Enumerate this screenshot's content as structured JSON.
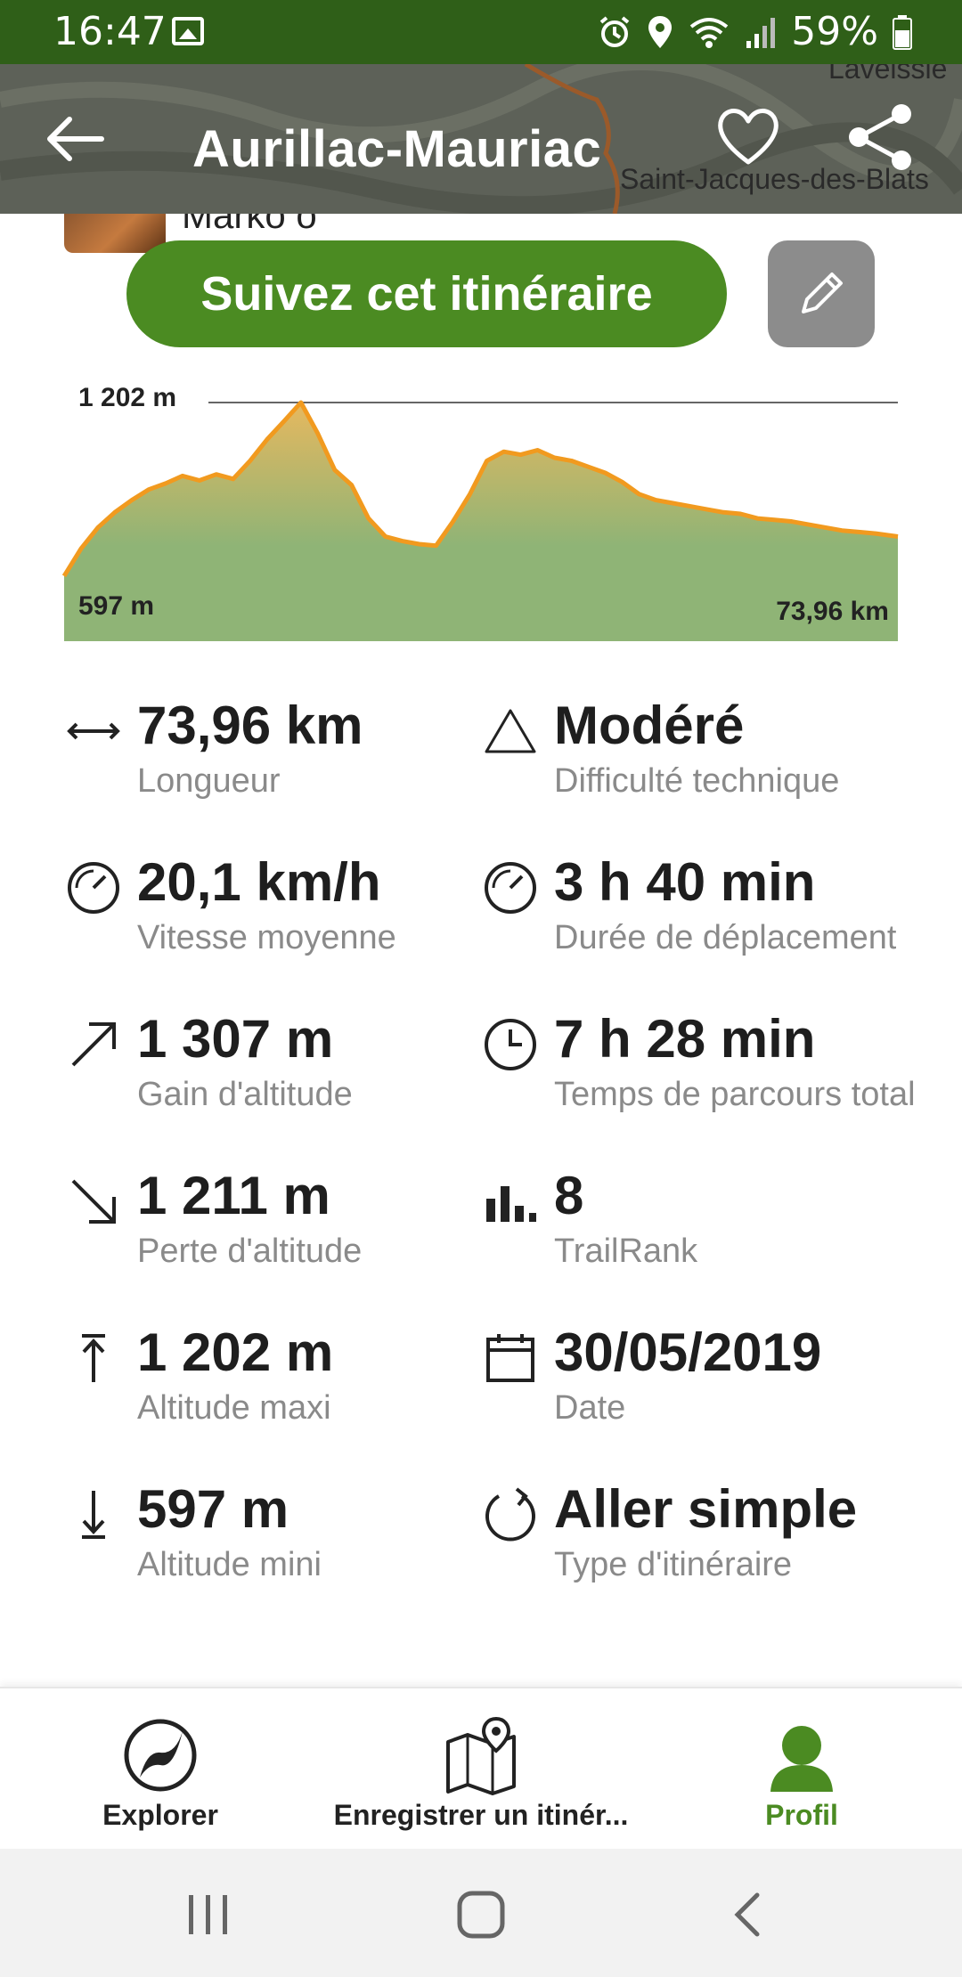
{
  "status_bar": {
    "time": "16:47",
    "battery": "59%"
  },
  "header": {
    "title": "Aurillac-Mauriac",
    "map_labels": [
      "Laveissie",
      "Saint-Jacques-des-Blats"
    ]
  },
  "author": {
    "name": "Marko o"
  },
  "actions": {
    "follow_label": "Suivez cet itinéraire"
  },
  "elevation": {
    "max_label": "1 202 m",
    "min_label": "597 m",
    "distance_label": "73,96 km",
    "fill_color": "#8fb476",
    "peak_color": "#e6b85f",
    "line_color": "#f19a1f"
  },
  "chart_data": {
    "type": "area",
    "title": "",
    "xlabel": "",
    "ylabel": "",
    "xlim": [
      0,
      73.96
    ],
    "ylim": [
      597,
      1202
    ],
    "x": [
      0,
      1.5,
      3,
      4.5,
      6,
      7.5,
      9,
      10.5,
      12,
      13.5,
      15,
      16.5,
      18,
      19.5,
      21,
      22.5,
      24,
      25.5,
      27,
      28.5,
      30,
      31.5,
      33,
      34.5,
      36,
      37.5,
      39,
      40.5,
      42,
      43.5,
      45,
      46.5,
      48,
      49.5,
      51,
      52.5,
      54,
      55.5,
      57,
      58.5,
      60,
      61.5,
      63,
      64.5,
      66,
      67.5,
      69,
      70.5,
      72,
      73.96
    ],
    "y": [
      630,
      720,
      790,
      840,
      880,
      915,
      935,
      960,
      945,
      965,
      950,
      1010,
      1080,
      1140,
      1202,
      1100,
      980,
      930,
      820,
      760,
      745,
      735,
      730,
      810,
      900,
      1010,
      1040,
      1030,
      1045,
      1020,
      1010,
      990,
      970,
      940,
      900,
      880,
      870,
      860,
      850,
      840,
      835,
      820,
      815,
      810,
      800,
      790,
      780,
      775,
      770,
      760
    ]
  },
  "stats": [
    {
      "icon": "distance-icon",
      "value": "73,96 km",
      "label": "Longueur"
    },
    {
      "icon": "difficulty-icon",
      "value": "Modéré",
      "label": "Difficulté technique"
    },
    {
      "icon": "speed-icon",
      "value": "20,1 km/h",
      "label": "Vitesse moyenne"
    },
    {
      "icon": "moving-time-icon",
      "value": "3 h 40 min",
      "label": "Durée de déplacement"
    },
    {
      "icon": "elevation-gain-icon",
      "value": "1 307 m",
      "label": "Gain d'altitude"
    },
    {
      "icon": "clock-icon",
      "value": "7 h 28 min",
      "label": "Temps de parcours total"
    },
    {
      "icon": "elevation-loss-icon",
      "value": "1 211 m",
      "label": "Perte d'altitude"
    },
    {
      "icon": "trailrank-icon",
      "value": "8",
      "label": "TrailRank"
    },
    {
      "icon": "max-altitude-icon",
      "value": "1 202 m",
      "label": "Altitude maxi"
    },
    {
      "icon": "calendar-icon",
      "value": "30/05/2019",
      "label": "Date"
    },
    {
      "icon": "min-altitude-icon",
      "value": "597 m",
      "label": "Altitude mini"
    },
    {
      "icon": "route-type-icon",
      "value": "Aller simple",
      "label": "Type d'itinéraire"
    }
  ],
  "bottom_nav": [
    {
      "icon": "explorer-icon",
      "label": "Explorer",
      "active": false
    },
    {
      "icon": "record-trail-icon",
      "label": "Enregistrer un itinér...",
      "active": false
    },
    {
      "icon": "profile-icon",
      "label": "Profil",
      "active": true
    }
  ],
  "colors": {
    "brand_green": "#4b8b22",
    "status_bar": "#2f5f18"
  }
}
